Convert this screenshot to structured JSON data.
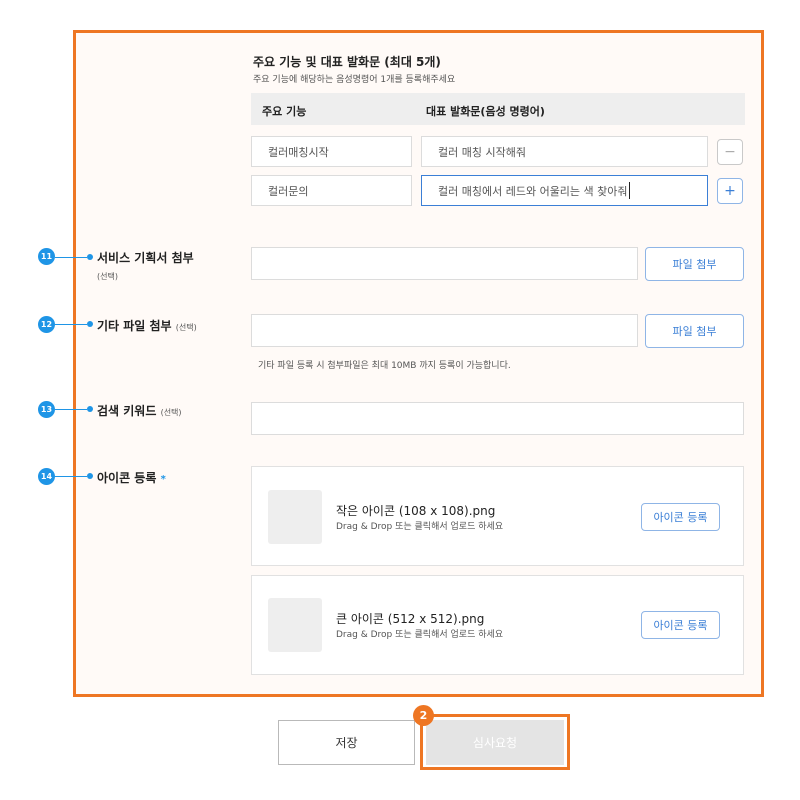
{
  "features_section": {
    "title": "주요 기능 및 대표 발화문 (최대 5개)",
    "subtitle": "주요 기능에 해당하는 음성명령어 1개를 등록해주세요",
    "col_feature": "주요 기능",
    "col_utterance": "대표 발화문(음성 명령어)",
    "rows": [
      {
        "feature": "컬러매칭시작",
        "utterance": "컬러 매칭 시작해줘",
        "action": "−"
      },
      {
        "feature": "컬러문의",
        "utterance": "컬러 매칭에서 레드와 어울리는 색 찾아줘",
        "action": "+"
      }
    ]
  },
  "markers": {
    "m11": "11",
    "m12": "12",
    "m13": "13",
    "m14": "14",
    "step": "2"
  },
  "service_plan": {
    "label": "서비스 기획서 첨부",
    "optional": "(선택)",
    "button": "파일 첨부"
  },
  "other_file": {
    "label": "기타 파일 첨부",
    "optional": "(선택)",
    "button": "파일 첨부",
    "help": "기타 파일 등록 시 첨부파일은 최대 10MB 까지 등록이 가능합니다."
  },
  "keywords": {
    "label": "검색 키워드",
    "optional": "(선택)"
  },
  "icon_reg": {
    "label": "아이콘 등록",
    "required_mark": "*",
    "items": [
      {
        "name": "작은 아이콘 (108 x 108).png",
        "hint": "Drag & Drop 또는 클릭해서 업로드 하세요",
        "button": "아이콘 등록"
      },
      {
        "name": "큰 아이콘 (512 x 512).png",
        "hint": "Drag & Drop 또는 클릭해서 업로드 하세요",
        "button": "아이콘 등록"
      }
    ]
  },
  "footer": {
    "save": "저장",
    "request_review": "심사요청"
  },
  "colors": {
    "highlight": "#ee7623",
    "marker": "#1f95e6",
    "link": "#3b7fd6"
  }
}
